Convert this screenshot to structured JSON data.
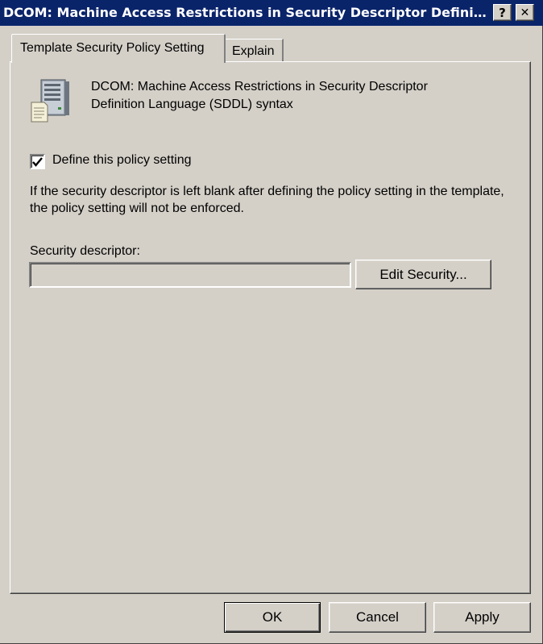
{
  "window": {
    "title": "DCOM: Machine Access Restrictions in Security Descriptor Definiti...",
    "help_glyph": "?",
    "close_glyph": "✕"
  },
  "tabs": [
    {
      "label": "Template Security Policy Setting",
      "active": true
    },
    {
      "label": "Explain",
      "active": false
    }
  ],
  "policy": {
    "icon": "server-with-document-icon",
    "title": "DCOM: Machine Access Restrictions in Security Descriptor Definition Language (SDDL) syntax"
  },
  "define_setting": {
    "label": "Define this policy setting",
    "checked": true
  },
  "info_text": "If the security descriptor is left blank after defining the policy setting in the template, the policy setting will not be enforced.",
  "security_descriptor": {
    "label": "Security descriptor:",
    "value": "",
    "edit_button": "Edit Security..."
  },
  "footer": {
    "ok": "OK",
    "cancel": "Cancel",
    "apply": "Apply"
  },
  "colors": {
    "titlebar": "#0a246a",
    "face": "#d4d0c8"
  }
}
